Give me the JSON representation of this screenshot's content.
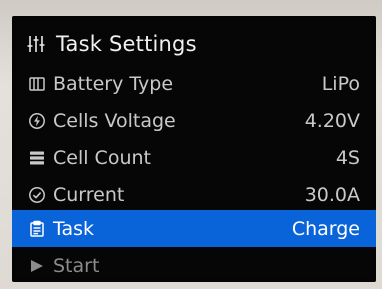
{
  "screen": {
    "title": "Task Settings",
    "title_icon": "sliders-icon",
    "items": [
      {
        "label": "Battery Type",
        "value": "LiPo",
        "icon": "battery-icon",
        "selected": false
      },
      {
        "label": "Cells Voltage",
        "value": "4.20V",
        "icon": "power-icon",
        "selected": false
      },
      {
        "label": "Cell Count",
        "value": "4S",
        "icon": "stack-icon",
        "selected": false
      },
      {
        "label": "Current",
        "value": "30.0A",
        "icon": "check-circle-icon",
        "selected": false
      },
      {
        "label": "Task",
        "value": "Charge",
        "icon": "clipboard-icon",
        "selected": true
      },
      {
        "label": "Start",
        "value": "",
        "icon": "play-icon",
        "selected": false
      }
    ]
  },
  "colors": {
    "background": "#060607",
    "text": "#c9c9c9",
    "highlight": "#0a64d9"
  }
}
